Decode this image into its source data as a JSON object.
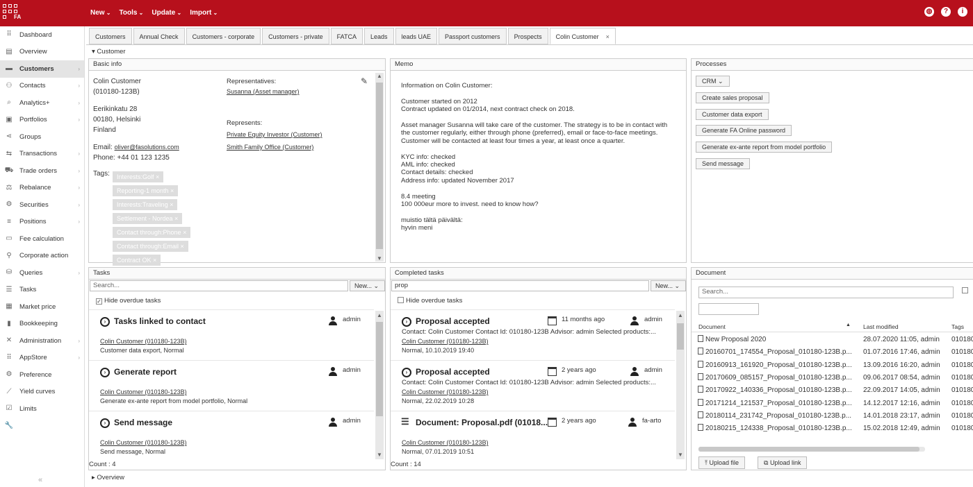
{
  "topbar": {
    "logo_text": "FA",
    "menu": [
      "New",
      "Tools",
      "Update",
      "Import"
    ],
    "icons": [
      "globe-icon",
      "help-icon",
      "info-icon"
    ]
  },
  "sidebar": {
    "items": [
      {
        "label": "Dashboard",
        "icon": "grid-icon",
        "arrow": false
      },
      {
        "label": "Overview",
        "icon": "overview-icon",
        "arrow": false
      },
      {
        "label": "Customers",
        "icon": "customers-icon",
        "arrow": true,
        "active": true
      },
      {
        "label": "Contacts",
        "icon": "contacts-icon",
        "arrow": true
      },
      {
        "label": "Analytics+",
        "icon": "analytics-icon",
        "arrow": true
      },
      {
        "label": "Portfolios",
        "icon": "portfolios-icon",
        "arrow": true
      },
      {
        "label": "Groups",
        "icon": "groups-icon",
        "arrow": false
      },
      {
        "label": "Transactions",
        "icon": "transactions-icon",
        "arrow": true
      },
      {
        "label": "Trade orders",
        "icon": "cart-icon",
        "arrow": true
      },
      {
        "label": "Rebalance",
        "icon": "scale-icon",
        "arrow": true
      },
      {
        "label": "Securities",
        "icon": "securities-icon",
        "arrow": true
      },
      {
        "label": "Positions",
        "icon": "positions-icon",
        "arrow": true
      },
      {
        "label": "Fee calculation",
        "icon": "fee-icon",
        "arrow": false
      },
      {
        "label": "Corporate action",
        "icon": "corporate-icon",
        "arrow": false
      },
      {
        "label": "Queries",
        "icon": "queries-icon",
        "arrow": true
      },
      {
        "label": "Tasks",
        "icon": "tasks-icon",
        "arrow": false
      },
      {
        "label": "Market price",
        "icon": "market-icon",
        "arrow": false
      },
      {
        "label": "Bookkeeping",
        "icon": "bookkeeping-icon",
        "arrow": false
      },
      {
        "label": "Administration",
        "icon": "admin-icon",
        "arrow": true
      },
      {
        "label": "AppStore",
        "icon": "appstore-icon",
        "arrow": true
      },
      {
        "label": "Preference",
        "icon": "preference-icon",
        "arrow": false
      },
      {
        "label": "Yield curves",
        "icon": "yield-icon",
        "arrow": false
      },
      {
        "label": "Limits",
        "icon": "limits-icon",
        "arrow": false
      },
      {
        "label": "",
        "icon": "wrench-icon",
        "arrow": false
      }
    ],
    "collapse": "«"
  },
  "tabs": [
    {
      "label": "Customers"
    },
    {
      "label": "Annual Check"
    },
    {
      "label": "Customers - corporate"
    },
    {
      "label": "Customers - private"
    },
    {
      "label": "FATCA"
    },
    {
      "label": "Leads"
    },
    {
      "label": "leads UAE"
    },
    {
      "label": "Passport customers"
    },
    {
      "label": "Prospects"
    },
    {
      "label": "Colin Customer",
      "active": true,
      "close": "×"
    }
  ],
  "section": {
    "customer": "Customer",
    "overview": "Overview"
  },
  "basic_info": {
    "title": "Basic info",
    "name": "Colin Customer",
    "id": "(010180-123B)",
    "street": "Eerikinkatu 28",
    "city": "00180, Helsinki",
    "country": "Finland",
    "email_label": "Email:",
    "email": "oliver@fasolutions.com",
    "phone": "Phone: +44 01 123 1235",
    "tags_label": "Tags:",
    "tags": [
      "Interests:Golf ×",
      "Reporting-1 month ×",
      "Interests:Traveling ×",
      "Settlement - Nordea ×",
      "Contact through:Phone ×",
      "Contact through:Email ×",
      "Contract OK ×"
    ],
    "representatives_label": "Representatives:",
    "representative": "Susanna (Asset manager)",
    "represents_label": "Represents:",
    "represents": [
      "Private Equity Investor (Customer)",
      "Smith Family Office (Customer)"
    ]
  },
  "memo": {
    "title": "Memo",
    "lines": [
      "Information on Colin Customer:",
      "",
      "Customer started on 2012",
      "Contract updated on 01/2014, next contract check on 2018.",
      "",
      "Asset manager Susanna will take care of the customer. The strategy is to be in contact with",
      "the customer regularly, either through phone (preferred), email or face-to-face meetings.",
      "Customer will be contacted at least four times a year, at least once a quarter.",
      "",
      "KYC info: checked",
      "AML info: checked",
      "Contact details: checked",
      "Address info: updated November 2017",
      "",
      "8.4 meeting",
      "100 000eur more to invest. need to know how?",
      "",
      "muistio tältä päivältä:",
      "hyvin meni"
    ]
  },
  "processes": {
    "title": "Processes",
    "buttons": [
      "CRM ⌄",
      "Create sales proposal",
      "Customer data export",
      "Generate FA Online password",
      "Generate ex-ante report from model portfolio",
      "Send message"
    ]
  },
  "tasks": {
    "title": "Tasks",
    "search_placeholder": "Search...",
    "new_label": "New... ⌄",
    "hide_overdue": "Hide overdue tasks",
    "items": [
      {
        "title": "Tasks linked to contact",
        "user": "admin",
        "link": "Colin Customer (010180-123B)",
        "desc": "Customer data export, Normal"
      },
      {
        "title": "Generate report",
        "user": "admin",
        "link": "Colin Customer (010180-123B)",
        "desc": "Generate ex-ante report from model portfolio, Normal"
      },
      {
        "title": "Send message",
        "user": "admin",
        "link": "Colin Customer (010180-123B)",
        "desc": "Send message, Normal"
      }
    ],
    "count": "Count : 4"
  },
  "completed": {
    "title": "Completed tasks",
    "search_value": "prop",
    "new_label": "New... ⌄",
    "hide_overdue": "Hide overdue tasks",
    "items": [
      {
        "title": "Proposal accepted",
        "when": "11 months ago",
        "user": "admin",
        "contact": "Contact: Colin Customer Contact Id: 010180-123B Advisor: admin Selected products:...",
        "link": "Colin Customer (010180-123B)",
        "desc": "Normal, 10.10.2019 19:40"
      },
      {
        "title": "Proposal accepted",
        "when": "2 years ago",
        "user": "admin",
        "contact": "Contact: Colin Customer Contact Id: 010180-123B Advisor: admin Selected products:...",
        "link": "Colin Customer (010180-123B)",
        "desc": "Normal, 22.02.2019 10:28"
      },
      {
        "title": "Document: Proposal.pdf (01018...",
        "when": "2 years ago",
        "user": "fa-arto",
        "contact": "",
        "link": "Colin Customer (010180-123B)",
        "desc": "Normal, 07.01.2019 10:51"
      }
    ],
    "count": "Count : 14"
  },
  "document": {
    "title": "Document",
    "search_placeholder": "Search...",
    "columns": [
      "Document",
      "Last modified",
      "Tags"
    ],
    "rows": [
      {
        "name": "New Proposal 2020",
        "modified": "28.07.2020 11:05, admin",
        "tags": "010180"
      },
      {
        "name": "20160701_174554_Proposal_010180-123B.p...",
        "modified": "01.07.2016 17:46, admin",
        "tags": "010180"
      },
      {
        "name": "20160913_161920_Proposal_010180-123B.p...",
        "modified": "13.09.2016 16:20, admin",
        "tags": "010180"
      },
      {
        "name": "20170609_085157_Proposal_010180-123B.p...",
        "modified": "09.06.2017 08:54, admin",
        "tags": "010180"
      },
      {
        "name": "20170922_140336_Proposal_010180-123B.p...",
        "modified": "22.09.2017 14:05, admin",
        "tags": "010180"
      },
      {
        "name": "20171214_121537_Proposal_010180-123B.p...",
        "modified": "14.12.2017 12:16, admin",
        "tags": "010180"
      },
      {
        "name": "20180114_231742_Proposal_010180-123B.p...",
        "modified": "14.01.2018 23:17, admin",
        "tags": "010180"
      },
      {
        "name": "20180215_124338_Proposal_010180-123B.p...",
        "modified": "15.02.2018 12:49, admin",
        "tags": "010180"
      }
    ],
    "upload_file": "Upload file",
    "upload_link": "Upload link"
  }
}
